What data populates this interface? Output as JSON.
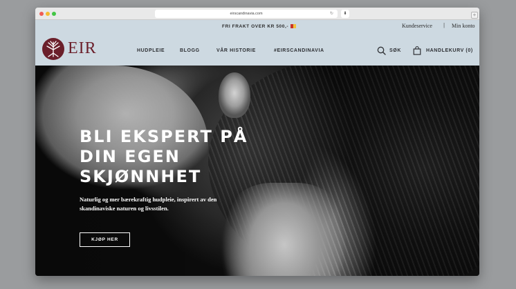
{
  "browser": {
    "url": "eirscandinavia.com"
  },
  "topbar": {
    "shipping": "FRI FRAKT OVER KR 500,-",
    "customer_service": "Kundeservice",
    "separator": "|",
    "account": "Min konto"
  },
  "brand": {
    "name": "EIR",
    "color": "#6b1f2a"
  },
  "nav": {
    "items": [
      "HUDPLEIE",
      "BLOGG",
      "VÅR HISTORIE",
      "#EIRSCANDINAVIA"
    ],
    "search": "SØK",
    "cart": "HANDLEKURV (0)"
  },
  "hero": {
    "headline": [
      "BLI EKSPERT PÅ",
      "DIN EGEN",
      "SKJØNNHET"
    ],
    "subtitle": "Naturlig og mer bærekraftig hudpleie, inspirert av den skandinaviske naturen og livsstilen.",
    "cta": "KJØP HER"
  },
  "icons": {
    "search": "search-icon",
    "cart": "shopping-bag-icon",
    "logo": "tree-logo-icon"
  },
  "colors": {
    "header_bg": "#cdd9e1",
    "text": "#2d2f33"
  }
}
